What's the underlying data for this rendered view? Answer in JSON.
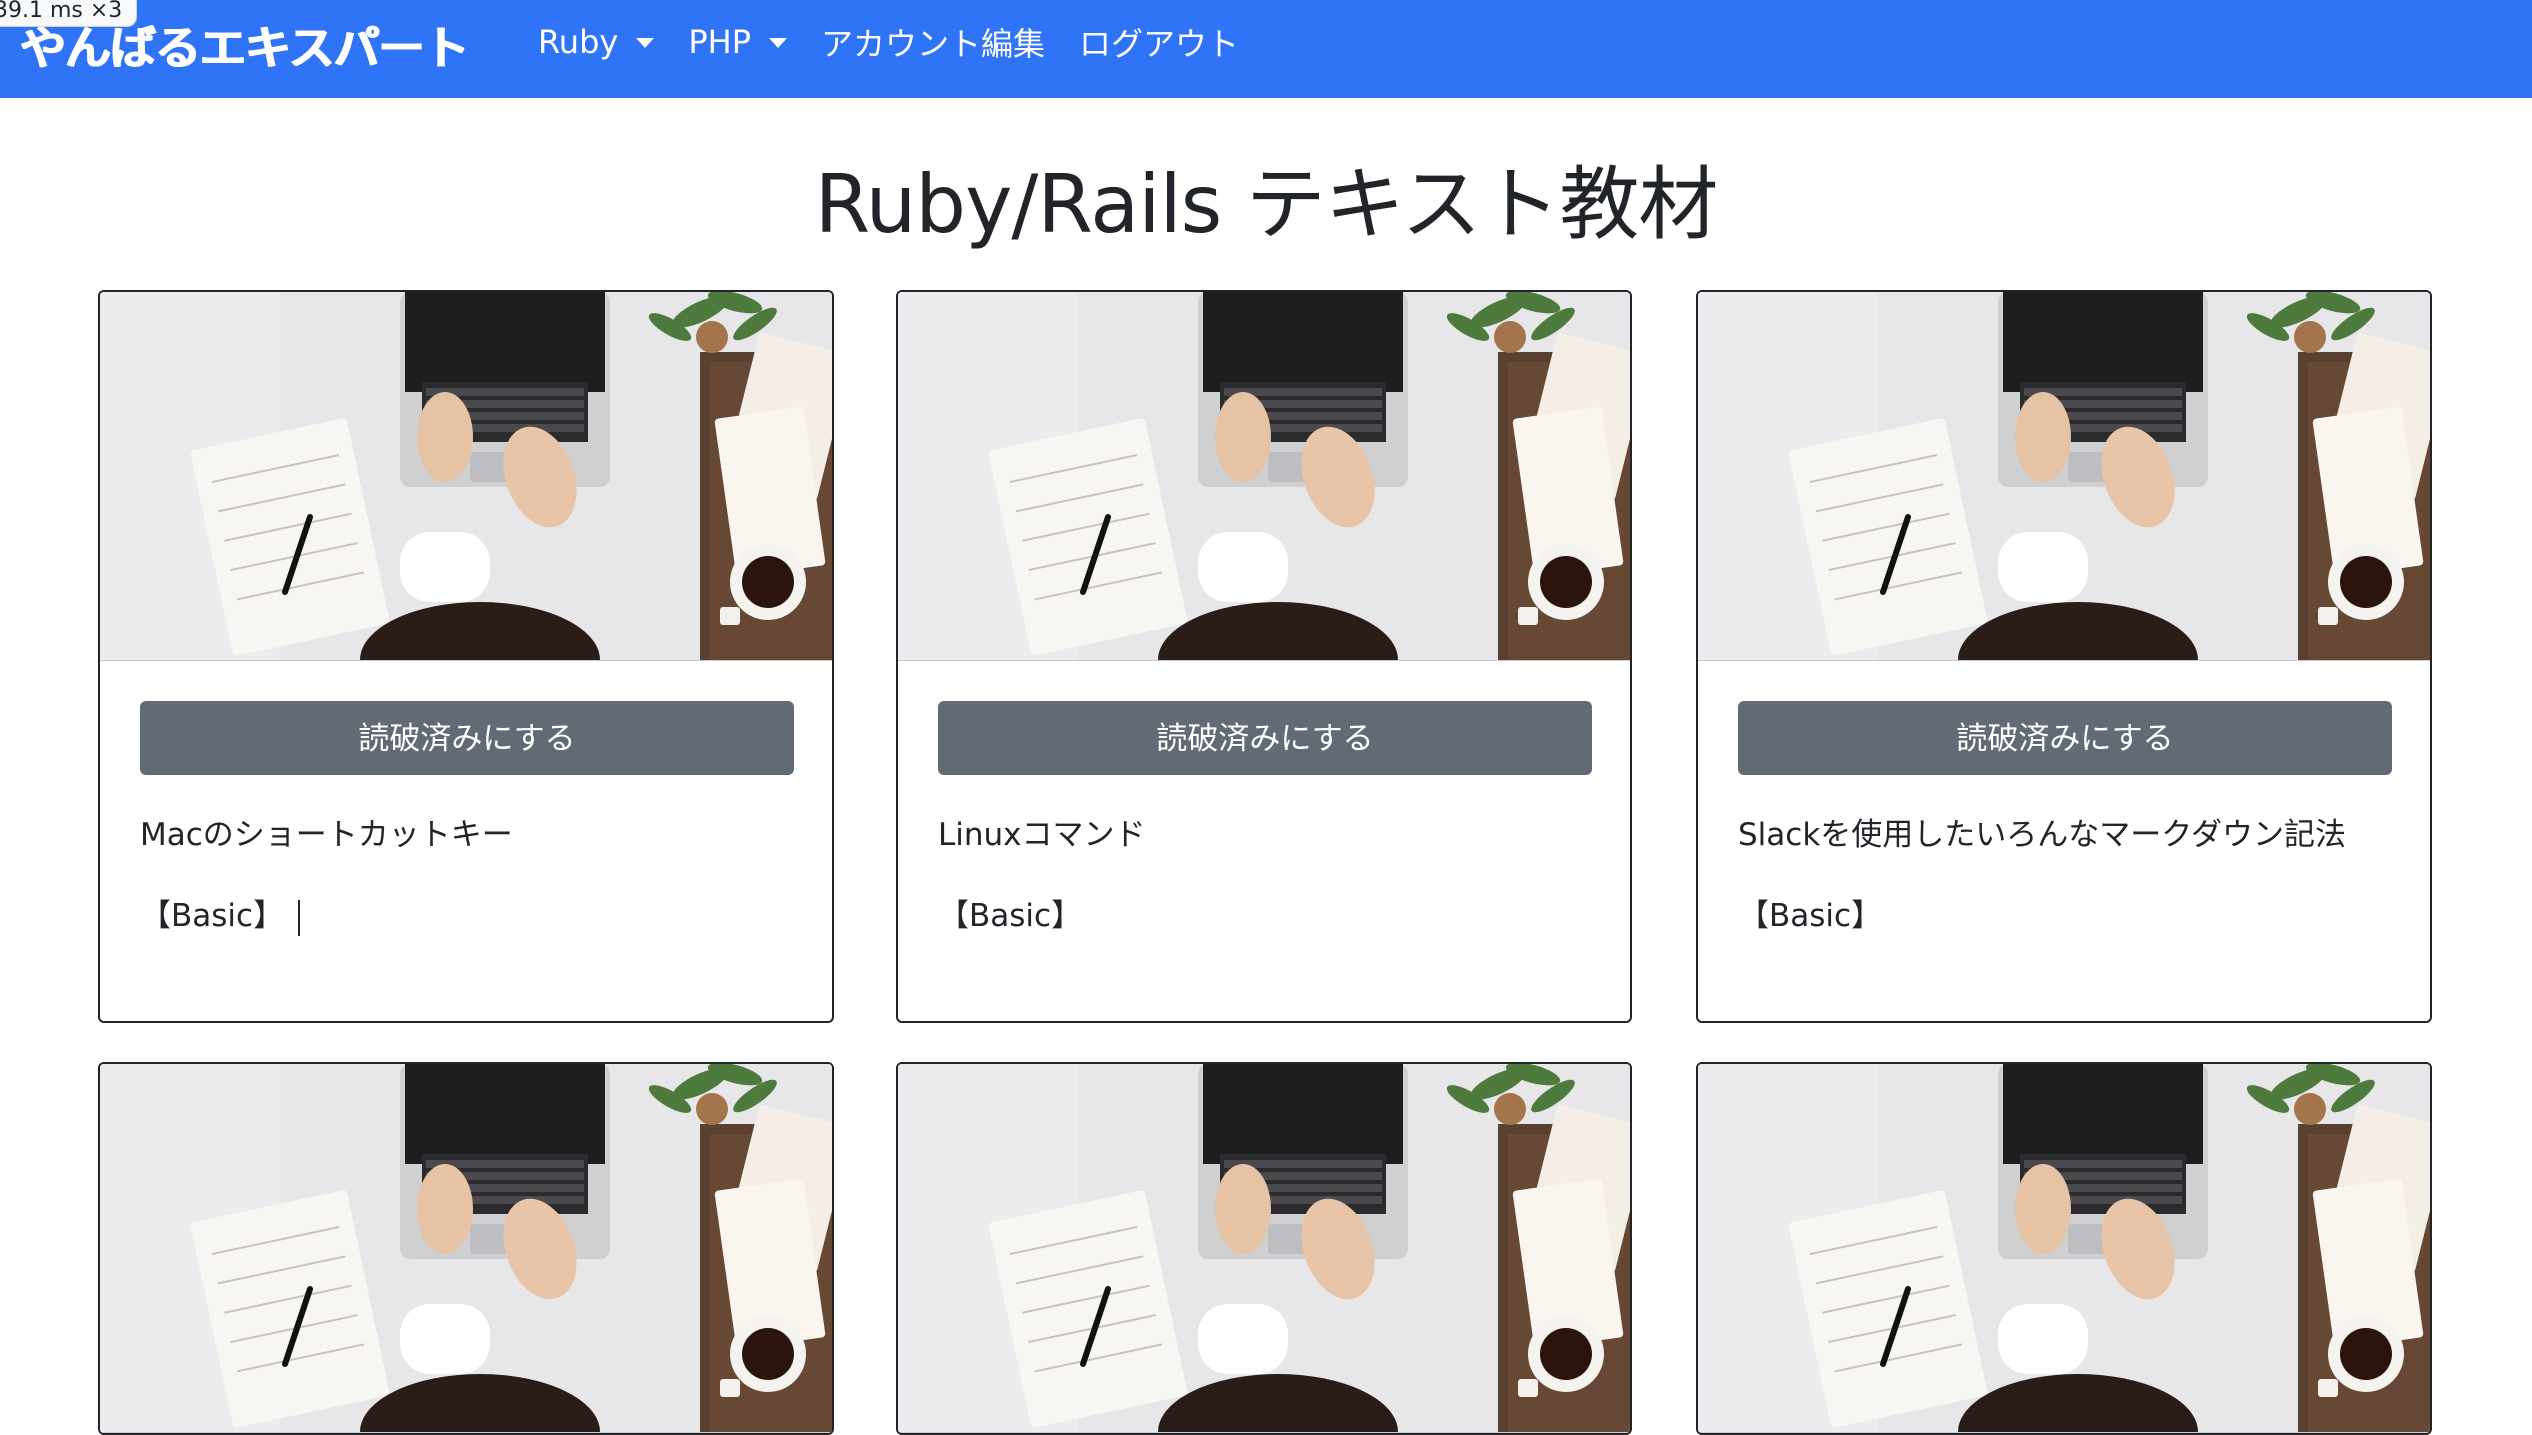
{
  "perf_badge": "39.1 ms ×3",
  "navbar": {
    "brand": "やんばるエキスパート",
    "items": [
      {
        "label": "Ruby",
        "dropdown": true
      },
      {
        "label": "PHP",
        "dropdown": true
      },
      {
        "label": "アカウント編集",
        "dropdown": false
      },
      {
        "label": "ログアウト",
        "dropdown": false
      }
    ],
    "color": "#2f73f7"
  },
  "page_title": "Ruby/Rails テキスト教材",
  "cards": [
    {
      "button": "読破済みにする",
      "title": "Macのショートカットキー",
      "level": "【Basic】"
    },
    {
      "button": "読破済みにする",
      "title": "Linuxコマンド",
      "level": "【Basic】"
    },
    {
      "button": "読破済みにする",
      "title": "Slackを使用したいろんなマークダウン記法",
      "level": "【Basic】"
    }
  ],
  "colors": {
    "button_bg": "#626b75",
    "text": "#212529"
  }
}
